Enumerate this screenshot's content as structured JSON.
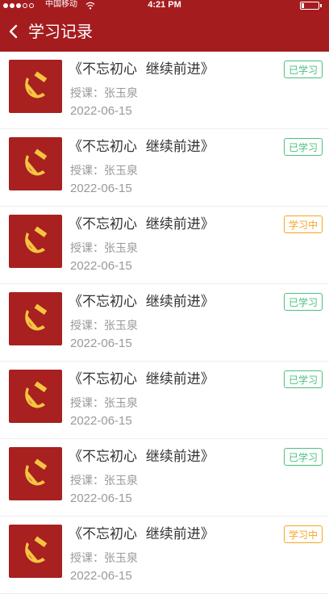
{
  "status_bar": {
    "carrier": "中国移动",
    "time": "4:21 PM"
  },
  "header": {
    "title": "学习记录"
  },
  "colors": {
    "brand_red": "#a51c1f",
    "badge_done": "#4cbf80",
    "badge_in_progress": "#f5a623"
  },
  "records": [
    {
      "title": "《不忘初心  继续前进》",
      "teacher": "授课：张玉泉",
      "date": "2022-06-15",
      "status": "已学习",
      "state": "done"
    },
    {
      "title": "《不忘初心  继续前进》",
      "teacher": "授课：张玉泉",
      "date": "2022-06-15",
      "status": "已学习",
      "state": "done"
    },
    {
      "title": "《不忘初心  继续前进》",
      "teacher": "授课：张玉泉",
      "date": "2022-06-15",
      "status": "学习中",
      "state": "learning"
    },
    {
      "title": "《不忘初心  继续前进》",
      "teacher": "授课：张玉泉",
      "date": "2022-06-15",
      "status": "已学习",
      "state": "done"
    },
    {
      "title": "《不忘初心  继续前进》",
      "teacher": "授课：张玉泉",
      "date": "2022-06-15",
      "status": "已学习",
      "state": "done"
    },
    {
      "title": "《不忘初心  继续前进》",
      "teacher": "授课：张玉泉",
      "date": "2022-06-15",
      "status": "已学习",
      "state": "done"
    },
    {
      "title": "《不忘初心  继续前进》",
      "teacher": "授课：张玉泉",
      "date": "2022-06-15",
      "status": "学习中",
      "state": "learning"
    }
  ]
}
